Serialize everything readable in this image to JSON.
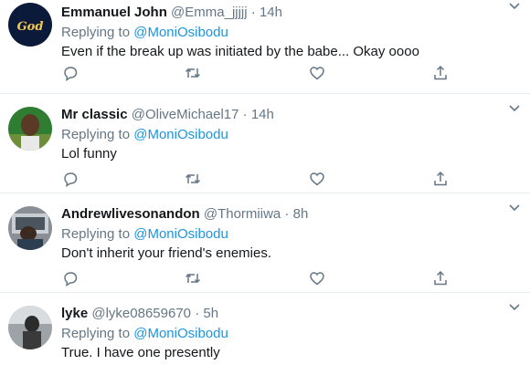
{
  "reply_prefix": "Replying to",
  "tweets": [
    {
      "name": "Emmanuel John",
      "handle": "@Emma_jjjjj",
      "sep": "·",
      "time": "14h",
      "mention": "@MoniOsibodu",
      "text": "Even if the break up was initiated by the babe... Okay oooo"
    },
    {
      "name": "Mr classic",
      "handle": "@OliveMichael17",
      "sep": "·",
      "time": "14h",
      "mention": "@MoniOsibodu",
      "text": "Lol funny"
    },
    {
      "name": "Andrewlivesonandon",
      "handle": "@Thormiiwa",
      "sep": "·",
      "time": "8h",
      "mention": "@MoniOsibodu",
      "text": "Don't  inherit your friend's enemies."
    },
    {
      "name": "lyke",
      "handle": "@lyke08659670",
      "sep": "·",
      "time": "5h",
      "mention": "@MoniOsibodu",
      "text": "True. I have one presently"
    }
  ],
  "colors": {
    "text": "#14171a",
    "secondary": "#657786",
    "link": "#1b95e0",
    "divider": "#e6ecf0"
  },
  "icons": [
    "reply-icon",
    "retweet-icon",
    "like-icon",
    "share-icon",
    "chevron-down-icon"
  ]
}
